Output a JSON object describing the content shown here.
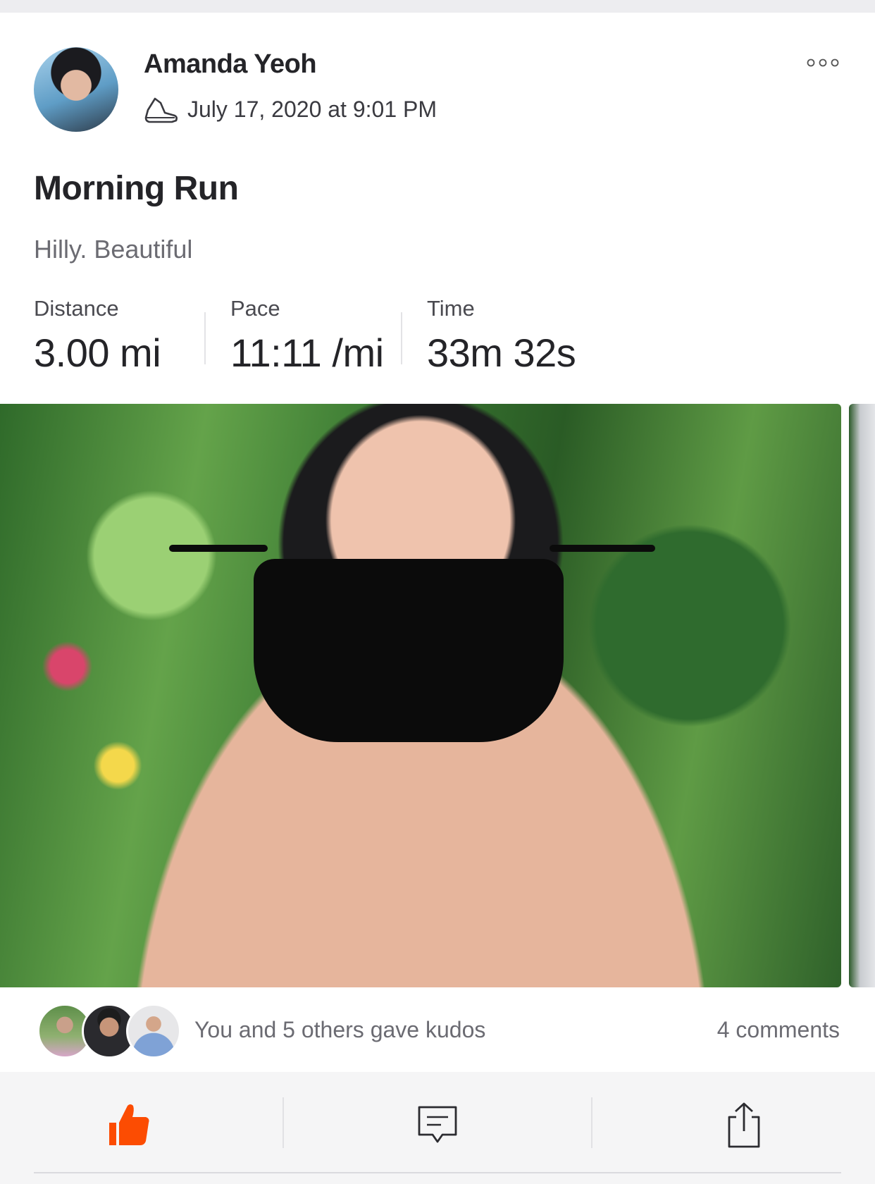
{
  "post": {
    "author": "Amanda Yeoh",
    "date": "July 17, 2020 at 9:01 PM",
    "activity_icon": "shoe-icon",
    "title": "Morning Run",
    "description": "Hilly. Beautiful",
    "stats": {
      "distance_label": "Distance",
      "distance_value": "3.00 mi",
      "pace_label": "Pace",
      "pace_value": "11:11 /mi",
      "time_label": "Time",
      "time_value": "33m 32s"
    }
  },
  "social": {
    "kudos_text": "You and 5 others gave kudos",
    "comments_text": "4 comments"
  },
  "actions": {
    "kudos_icon": "thumbs-up-icon",
    "comment_icon": "comment-icon",
    "share_icon": "share-icon"
  },
  "colors": {
    "accent": "#fc4c02",
    "text_primary": "#242428",
    "text_secondary": "#6b6b72"
  }
}
